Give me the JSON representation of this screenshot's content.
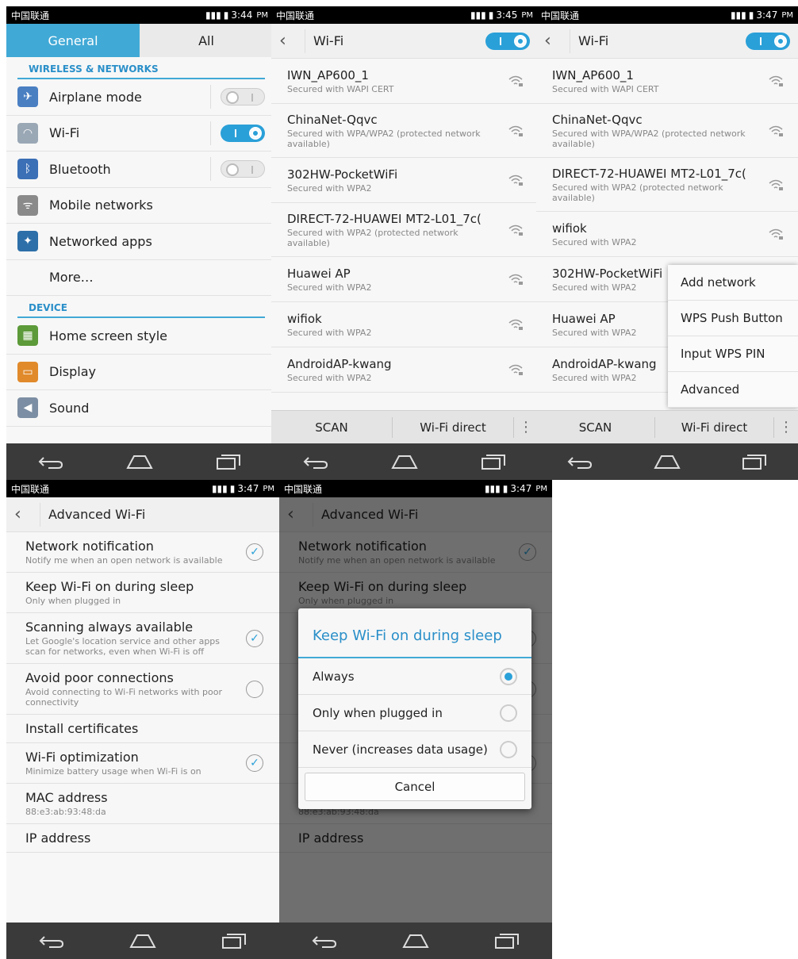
{
  "status_bars": [
    {
      "carrier": "中国联通",
      "time": "3:44",
      "ampm": "PM"
    },
    {
      "carrier": "中国联通",
      "time": "3:45",
      "ampm": "PM"
    },
    {
      "carrier": "中国联通",
      "time": "3:47",
      "ampm": "PM"
    },
    {
      "carrier": "中国联通",
      "time": "3:47",
      "ampm": "PM"
    },
    {
      "carrier": "中国联通",
      "time": "3:47",
      "ampm": "PM"
    }
  ],
  "settings": {
    "tabs": [
      "General",
      "All"
    ],
    "section_wireless": "WIRELESS & NETWORKS",
    "section_device": "DEVICE",
    "items": [
      {
        "label": "Airplane mode",
        "icon": "airplane-icon",
        "switch": "off",
        "color": "#4a7fc2"
      },
      {
        "label": "Wi-Fi",
        "icon": "wifi-icon",
        "switch": "on",
        "color": "#9aa7b5"
      },
      {
        "label": "Bluetooth",
        "icon": "bluetooth-icon",
        "switch": "off",
        "color": "#3b6fb6"
      },
      {
        "label": "Mobile networks",
        "icon": "antenna-icon",
        "color": "#8a8a8a"
      },
      {
        "label": "Networked apps",
        "icon": "apps-icon",
        "color": "#2d6fa8"
      },
      {
        "label": "More…"
      }
    ],
    "device_items": [
      {
        "label": "Home screen style",
        "icon": "home-style-icon",
        "color": "#5d9a3a"
      },
      {
        "label": "Display",
        "icon": "display-icon",
        "color": "#e08a2b"
      },
      {
        "label": "Sound",
        "icon": "sound-icon",
        "color": "#7c8ea3"
      }
    ]
  },
  "wifi": {
    "title": "Wi-Fi",
    "networks_a": [
      {
        "name": "IWN_AP600_1",
        "sub": "Secured with WAPI CERT"
      },
      {
        "name": "ChinaNet-Qqvc",
        "sub": "Secured with WPA/WPA2 (protected network available)"
      },
      {
        "name": "302HW-PocketWiFi",
        "sub": "Secured with WPA2"
      },
      {
        "name": "DIRECT-72-HUAWEI MT2-L01_7c(",
        "sub": "Secured with WPA2 (protected network available)"
      },
      {
        "name": "Huawei AP",
        "sub": "Secured with WPA2"
      },
      {
        "name": "wifiok",
        "sub": "Secured with WPA2"
      },
      {
        "name": "AndroidAP-kwang",
        "sub": "Secured with WPA2"
      }
    ],
    "networks_b": [
      {
        "name": "IWN_AP600_1",
        "sub": "Secured with WAPI CERT"
      },
      {
        "name": "ChinaNet-Qqvc",
        "sub": "Secured with WPA/WPA2 (protected network available)"
      },
      {
        "name": "DIRECT-72-HUAWEI MT2-L01_7c(",
        "sub": "Secured with WPA2 (protected network available)"
      },
      {
        "name": "wifiok",
        "sub": "Secured with WPA2"
      },
      {
        "name": "302HW-PocketWiFi",
        "sub": "Secured with WPA2"
      },
      {
        "name": "Huawei AP",
        "sub": "Secured with WPA2"
      },
      {
        "name": "AndroidAP-kwang",
        "sub": "Secured with WPA2"
      }
    ],
    "scan": "SCAN",
    "direct": "Wi-Fi direct",
    "menu": [
      "Add network",
      "WPS Push Button",
      "Input WPS PIN",
      "Advanced"
    ]
  },
  "advanced": {
    "title": "Advanced Wi-Fi",
    "rows": [
      {
        "title": "Network notification",
        "sub": "Notify me when an open network is available",
        "check": "checked"
      },
      {
        "title": "Keep Wi-Fi on during sleep",
        "sub": "Only when plugged in",
        "check": "none"
      },
      {
        "title": "Scanning always available",
        "sub": "Let Google's location service and other apps scan for networks, even when Wi-Fi is off",
        "check": "checked"
      },
      {
        "title": "Avoid poor connections",
        "sub": "Avoid connecting to Wi-Fi networks with poor connectivity",
        "check": "unchecked"
      },
      {
        "title": "Install certificates",
        "sub": "",
        "check": "none"
      },
      {
        "title": "Wi-Fi optimization",
        "sub": "Minimize battery usage when Wi-Fi is on",
        "check": "checked"
      },
      {
        "title": "MAC address",
        "sub": "88:e3:ab:93:48:da",
        "check": "none"
      },
      {
        "title": "IP address",
        "sub": "",
        "check": "none"
      }
    ]
  },
  "dialog": {
    "title": "Keep Wi-Fi on during sleep",
    "options": [
      "Always",
      "Only when plugged in",
      "Never (increases data usage)"
    ],
    "selected": 0,
    "cancel": "Cancel"
  },
  "colors": {
    "accent": "#41a9d6",
    "navbar": "#3a3a3a"
  }
}
